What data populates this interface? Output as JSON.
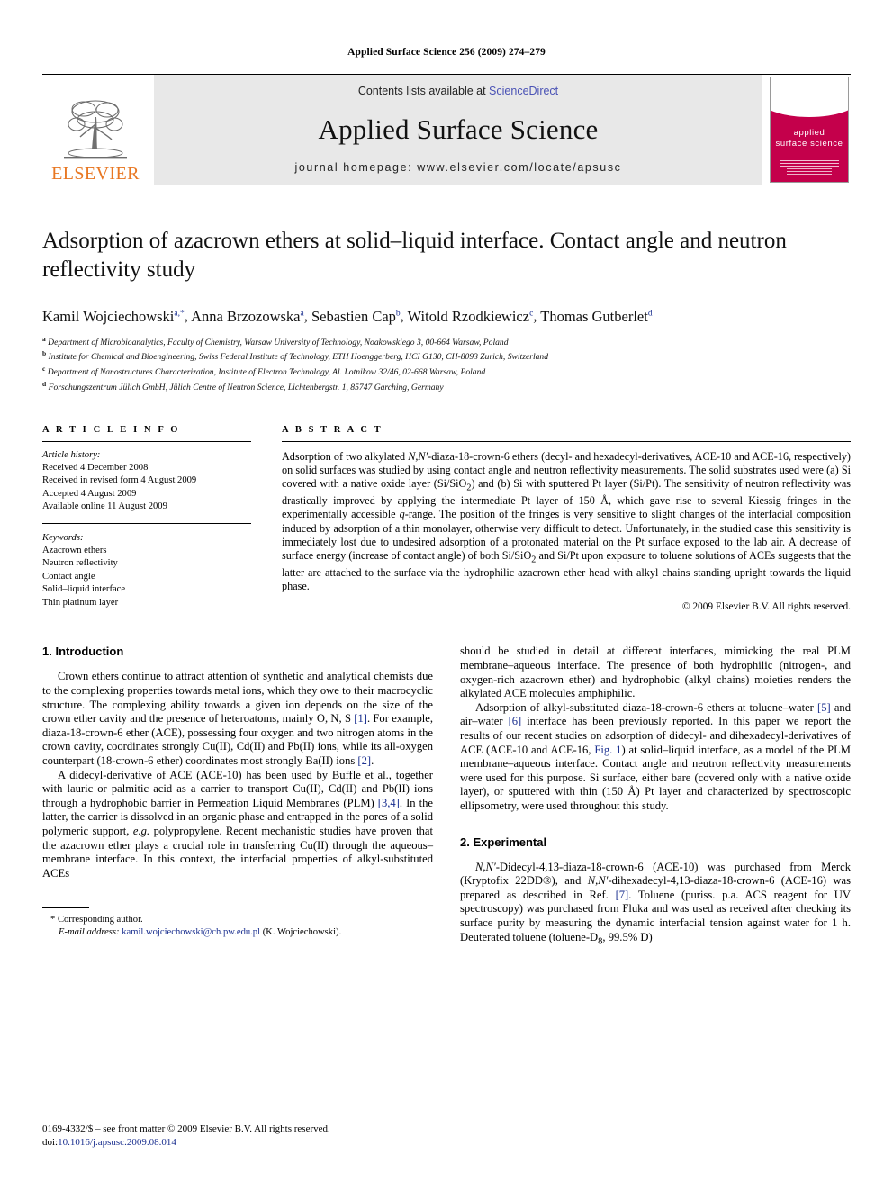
{
  "running_head": "Applied Surface Science 256 (2009) 274–279",
  "masthead": {
    "publisher_wordmark": "ELSEVIER",
    "contents_prefix": "Contents lists available at ",
    "sciencedirect": "ScienceDirect",
    "journal_name": "Applied Surface Science",
    "homepage": "journal homepage: www.elsevier.com/locate/apsusc",
    "cover_title_line1": "applied",
    "cover_title_line2": "surface science"
  },
  "article": {
    "title": "Adsorption of azacrown ethers at solid–liquid interface. Contact angle and neutron reflectivity study",
    "authors": [
      {
        "name": "Kamil Wojciechowski",
        "marks": "a,*"
      },
      {
        "name": "Anna Brzozowska",
        "marks": "a"
      },
      {
        "name": "Sebastien Cap",
        "marks": "b"
      },
      {
        "name": "Witold Rzodkiewicz",
        "marks": "c"
      },
      {
        "name": "Thomas Gutberlet",
        "marks": "d"
      }
    ],
    "affiliations": [
      {
        "mark": "a",
        "text": "Department of Microbioanalytics, Faculty of Chemistry, Warsaw University of Technology, Noakowskiego 3, 00-664 Warsaw, Poland"
      },
      {
        "mark": "b",
        "text": "Institute for Chemical and Bioengineering, Swiss Federal Institute of Technology, ETH Hoenggerberg, HCI G130, CH-8093 Zurich, Switzerland"
      },
      {
        "mark": "c",
        "text": "Department of Nanostructures Characterization, Institute of Electron Technology, Al. Lotnikow 32/46, 02-668 Warsaw, Poland"
      },
      {
        "mark": "d",
        "text": "Forschungszentrum Jülich GmbH, Jülich Centre of Neutron Science, Lichtenbergstr. 1, 85747 Garching, Germany"
      }
    ]
  },
  "article_info": {
    "label": "A R T I C L E  I N F O",
    "history_label": "Article history:",
    "history": [
      "Received 4 December 2008",
      "Received in revised form 4 August 2009",
      "Accepted 4 August 2009",
      "Available online 11 August 2009"
    ],
    "keywords_label": "Keywords:",
    "keywords": [
      "Azacrown ethers",
      "Neutron reflectivity",
      "Contact angle",
      "Solid–liquid interface",
      "Thin platinum layer"
    ]
  },
  "abstract": {
    "label": "A B S T R A C T",
    "text": "Adsorption of two alkylated N,N′-diaza-18-crown-6 ethers (decyl- and hexadecyl-derivatives, ACE-10 and ACE-16, respectively) on solid surfaces was studied by using contact angle and neutron reflectivity measurements. The solid substrates used were (a) Si covered with a native oxide layer (Si/SiO2) and (b) Si with sputtered Pt layer (Si/Pt). The sensitivity of neutron reflectivity was drastically improved by applying the intermediate Pt layer of 150 Å, which gave rise to several Kiessig fringes in the experimentally accessible q-range. The position of the fringes is very sensitive to slight changes of the interfacial composition induced by adsorption of a thin monolayer, otherwise very difficult to detect. Unfortunately, in the studied case this sensitivity is immediately lost due to undesired adsorption of a protonated material on the Pt surface exposed to the lab air. A decrease of surface energy (increase of contact angle) of both Si/SiO2 and Si/Pt upon exposure to toluene solutions of ACEs suggests that the latter are attached to the surface via the hydrophilic azacrown ether head with alkyl chains standing upright towards the liquid phase.",
    "copyright": "© 2009 Elsevier B.V. All rights reserved."
  },
  "sections": {
    "introduction_heading": "1. Introduction",
    "experimental_heading": "2. Experimental",
    "intro_p1": "Crown ethers continue to attract attention of synthetic and analytical chemists due to the complexing properties towards metal ions, which they owe to their macrocyclic structure. The complexing ability towards a given ion depends on the size of the crown ether cavity and the presence of heteroatoms, mainly O, N, S [1]. For example, diaza-18-crown-6 ether (ACE), possessing four oxygen and two nitrogen atoms in the crown cavity, coordinates strongly Cu(II), Cd(II) and Pb(II) ions, while its all-oxygen counterpart (18-crown-6 ether) coordinates most strongly Ba(II) ions [2].",
    "intro_p2": "A didecyl-derivative of ACE (ACE-10) has been used by Buffle et al., together with lauric or palmitic acid as a carrier to transport Cu(II), Cd(II) and Pb(II) ions through a hydrophobic barrier in Permeation Liquid Membranes (PLM) [3,4]. In the latter, the carrier is dissolved in an organic phase and entrapped in the pores of a solid polymeric support, e.g. polypropylene. Recent mechanistic studies have proven that the azacrown ether plays a crucial role in transferring Cu(II) through the aqueous–membrane interface. In this context, the interfacial properties of alkyl-substituted ACEs",
    "intro_p3": "should be studied in detail at different interfaces, mimicking the real PLM membrane–aqueous interface. The presence of both hydrophilic (nitrogen-, and oxygen-rich azacrown ether) and hydrophobic (alkyl chains) moieties renders the alkylated ACE molecules amphiphilic.",
    "intro_p4": "Adsorption of alkyl-substituted diaza-18-crown-6 ethers at toluene–water [5] and air–water [6] interface has been previously reported. In this paper we report the results of our recent studies on adsorption of didecyl- and dihexadecyl-derivatives of ACE (ACE-10 and ACE-16, Fig. 1) at solid–liquid interface, as a model of the PLM membrane–aqueous interface. Contact angle and neutron reflectivity measurements were used for this purpose. Si surface, either bare (covered only with a native oxide layer), or sputtered with thin (150 Å) Pt layer and characterized by spectroscopic ellipsometry, were used throughout this study.",
    "experimental_p1": "N,N′-Didecyl-4,13-diaza-18-crown-6 (ACE-10) was purchased from Merck (Kryptofix 22DD®), and N,N′-dihexadecyl-4,13-diaza-18-crown-6 (ACE-16) was prepared as described in Ref. [7]. Toluene (puriss. p.a. ACS reagent for UV spectroscopy) was purchased from Fluka and was used as received after checking its surface purity by measuring the dynamic interfacial tension against water for 1 h. Deuterated toluene (toluene-D8, 99.5% D)"
  },
  "footnote": {
    "corresponding": "* Corresponding author.",
    "email_label": "E-mail address:",
    "email": "kamil.wojciechowski@ch.pw.edu.pl",
    "email_suffix": "(K. Wojciechowski)."
  },
  "page_footer": {
    "front_matter": "0169-4332/$ – see front matter © 2009 Elsevier B.V. All rights reserved.",
    "doi_label": "doi:",
    "doi": "10.1016/j.apsusc.2009.08.014"
  },
  "colors": {
    "elsevier_orange": "#e87722",
    "link_blue": "#1a2f8f",
    "sciencedirect_blue": "#4a52b5",
    "cover_crimson": "#c4004b"
  }
}
